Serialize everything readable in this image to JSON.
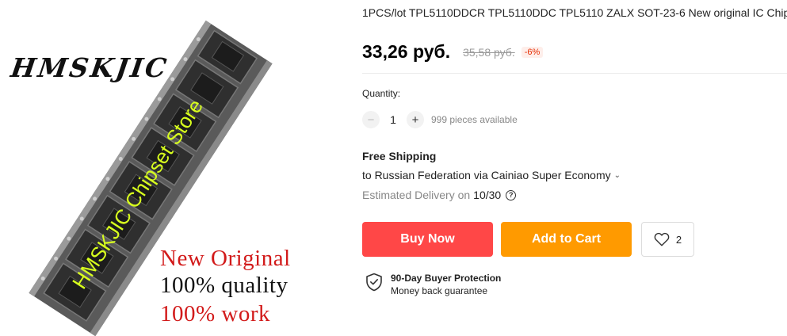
{
  "image": {
    "brand_watermark": "HMSKJIC",
    "store_watermark": "HMSKJIC Chipset Store",
    "promo_lines": [
      "New Original",
      "100% quality",
      "100% work"
    ],
    "promo_colors": [
      "#d21a1a",
      "#111111",
      "#d21a1a"
    ]
  },
  "product": {
    "title": "1PCS/lot TPL5110DDCR TPL5110DDC TPL5110 ZALX SOT-23-6 New original IC Chip"
  },
  "price": {
    "current": "33,26 руб.",
    "original": "35,58 руб.",
    "discount": "-6%"
  },
  "quantity": {
    "label": "Quantity:",
    "value": "1",
    "available": "999 pieces available"
  },
  "shipping": {
    "title": "Free Shipping",
    "destination": "to Russian Federation via Cainiao Super Economy",
    "delivery_label": "Estimated Delivery on",
    "delivery_date": "10/30"
  },
  "actions": {
    "buy_now": "Buy Now",
    "add_to_cart": "Add to Cart",
    "wishlist_count": "2"
  },
  "protection": {
    "title": "90-Day Buyer Protection",
    "subtitle": "Money back guarantee"
  },
  "colors": {
    "buy_now": "#ff4747",
    "add_to_cart": "#ff9a00",
    "discount": "#e62e04"
  }
}
